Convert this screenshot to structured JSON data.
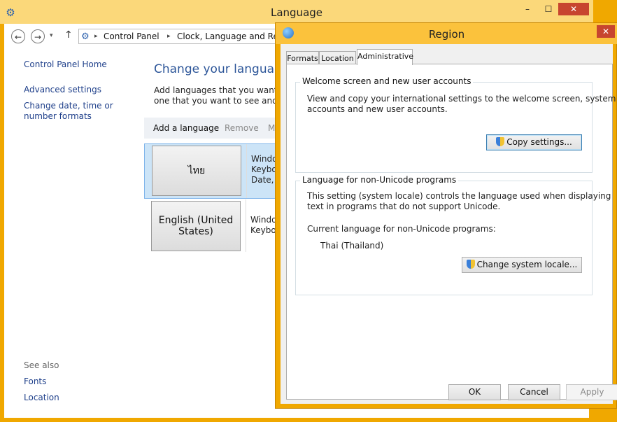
{
  "language_window": {
    "title": "Language",
    "app_icon": "language-icon",
    "caption": {
      "minimize": "–",
      "maximize": "☐",
      "close": "✕"
    },
    "nav": {
      "back": "←",
      "forward": "→",
      "recent": "▾",
      "up": "↑",
      "breadcrumb": [
        "Control Panel",
        "Clock, Language and Region"
      ],
      "separator": "▸"
    },
    "sidebar": {
      "home": "Control Panel Home",
      "advanced": "Advanced settings",
      "date_formats": "Change date, time or number formats",
      "see_also": "See also",
      "fonts": "Fonts",
      "location": "Location"
    },
    "heading": "Change your language pr",
    "description_line1": "Add languages that you want to u",
    "description_line2": "one that you want to see and use",
    "toolbar": {
      "add": "Add a language",
      "remove": "Remove",
      "more": "M"
    },
    "languages": [
      {
        "name": "ไทย",
        "info": [
          "Windo",
          "Keybo",
          "Date, ti"
        ]
      },
      {
        "name": "English (United States)",
        "info": [
          "Windo",
          "Keybo"
        ]
      }
    ]
  },
  "region_dialog": {
    "title": "Region",
    "close": "✕",
    "tabs": [
      "Formats",
      "Location",
      "Administrative"
    ],
    "active_tab": "Administrative",
    "welcome_group": {
      "title": "Welcome screen and new user accounts",
      "text_line1": "View and copy your international settings to the welcome screen, system",
      "text_line2": "accounts and new user accounts.",
      "button": "Copy settings..."
    },
    "unicode_group": {
      "title": "Language for non-Unicode programs",
      "text_line1": "This setting (system locale) controls the language used when displaying",
      "text_line2": "text in programs that do not support Unicode.",
      "current_label": "Current language for non-Unicode programs:",
      "current_value": "Thai (Thailand)",
      "button": "Change system locale..."
    },
    "buttons": {
      "ok": "OK",
      "cancel": "Cancel",
      "apply": "Apply"
    }
  }
}
